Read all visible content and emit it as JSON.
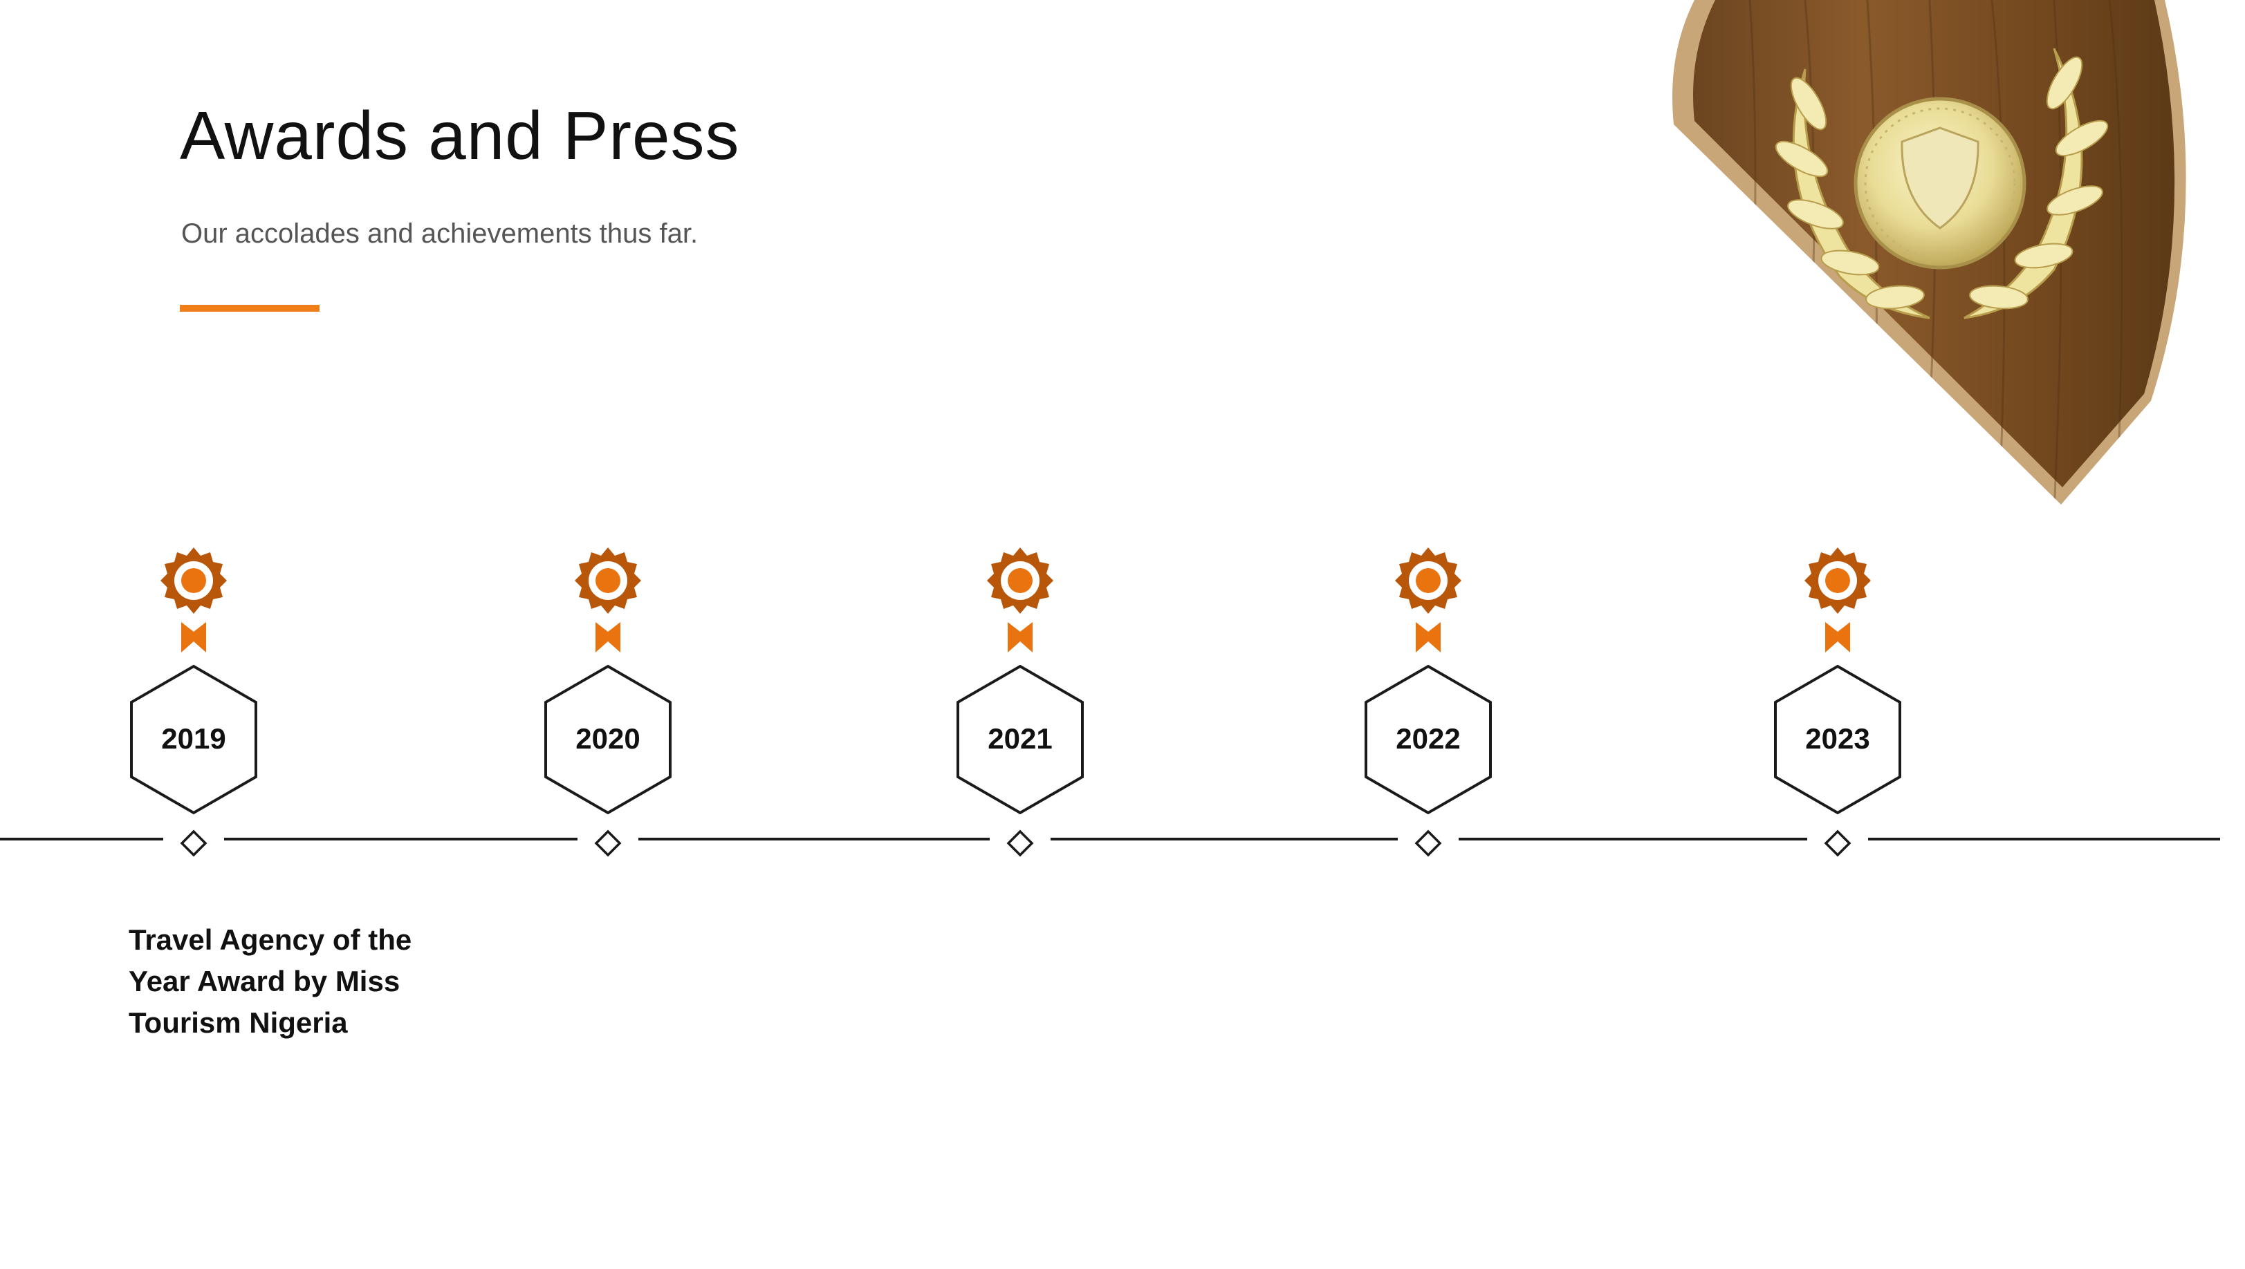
{
  "header": {
    "title": "Awards and Press",
    "subtitle": "Our accolades and achievements thus far."
  },
  "colors": {
    "accent": "#F07F1A",
    "award_outer": "#B8570A",
    "award_inner": "#E8730F",
    "line": "#1a1a1a"
  },
  "timeline": {
    "milestones": [
      {
        "year": "2019"
      },
      {
        "year": "2020"
      },
      {
        "year": "2021"
      },
      {
        "year": "2022"
      },
      {
        "year": "2023"
      }
    ],
    "award_text": "Travel Agency  of the\nYear Award by Miss\nTourism Nigeria"
  }
}
